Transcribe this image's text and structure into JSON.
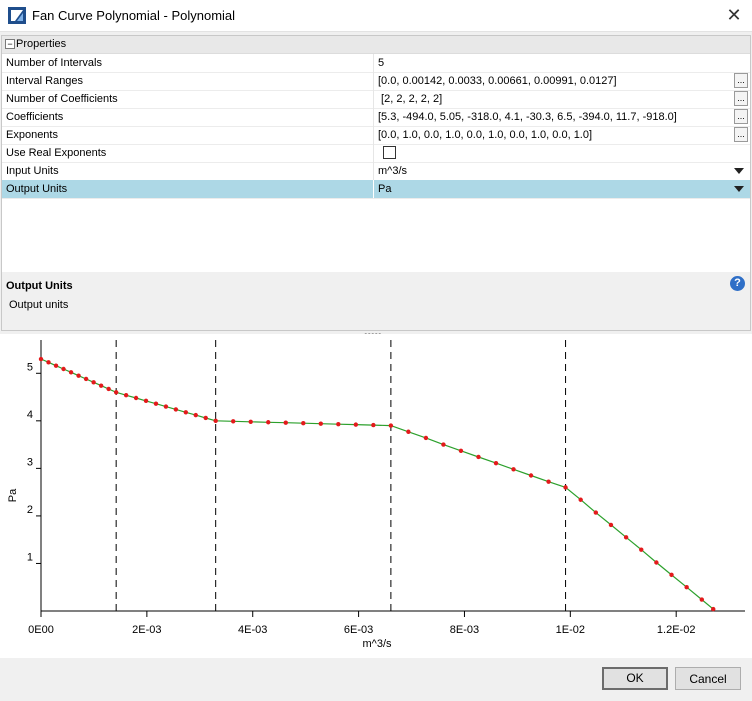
{
  "window": {
    "title": "Fan Curve Polynomial - Polynomial",
    "close_icon": "close-icon"
  },
  "properties": {
    "category": "Properties",
    "rows": [
      {
        "name": "Number of Intervals",
        "value": "5"
      },
      {
        "name": "Interval Ranges",
        "value": "[0.0, 0.00142, 0.0033, 0.00661, 0.00991, 0.0127]",
        "button": "..."
      },
      {
        "name": "Number of Coefficients",
        "value": " [2, 2, 2, 2, 2]",
        "button": "..."
      },
      {
        "name": "Coefficients",
        "value": "[5.3, -494.0, 5.05, -318.0, 4.1, -30.3, 6.5, -394.0, 11.7, -918.0]",
        "button": "..."
      },
      {
        "name": "Exponents",
        "value": "[0.0, 1.0, 0.0, 1.0, 0.0, 1.0, 0.0, 1.0, 0.0, 1.0]",
        "button": "..."
      },
      {
        "name": "Use Real Exponents",
        "value": "",
        "checked": false
      },
      {
        "name": "Input Units",
        "value": "m^3/s"
      },
      {
        "name": "Output Units",
        "value": "Pa",
        "selected": true
      }
    ]
  },
  "help": {
    "title": "Output Units",
    "description": "Output units",
    "icon": "help-icon",
    "icon_text": "?"
  },
  "splitter_grip": "•••••",
  "chart_data": {
    "type": "line",
    "xlabel": "m^3/s",
    "ylabel": "Pa",
    "xlim": [
      0,
      0.0133
    ],
    "ylim": [
      0,
      5.7
    ],
    "x_ticks": [
      0,
      0.002,
      0.004,
      0.006,
      0.008,
      0.01,
      0.012
    ],
    "x_tick_labels": [
      "0E00",
      "2E-03",
      "4E-03",
      "6E-03",
      "8E-03",
      "1E-02",
      "1.2E-02"
    ],
    "y_ticks": [
      1,
      2,
      3,
      4,
      5
    ],
    "y_tick_labels": [
      "1",
      "2",
      "3",
      "4",
      "5"
    ],
    "interval_boundaries": [
      0.00142,
      0.0033,
      0.00661,
      0.00991
    ],
    "line_color": "#2ca02c",
    "marker_color": "#e31a1c",
    "series": [
      {
        "x": [
          0,
          0.000142,
          0.000284,
          0.000426,
          0.000568,
          0.00071,
          0.000852,
          0.000994,
          0.001136,
          0.001278,
          0.00142,
          0.001608,
          0.001796,
          0.001984,
          0.002172,
          0.00236,
          0.002548,
          0.002736,
          0.002924,
          0.003112,
          0.0033,
          0.003631,
          0.003962,
          0.004293,
          0.004624,
          0.004955,
          0.005286,
          0.005617,
          0.005948,
          0.006279,
          0.00661,
          0.006941,
          0.007272,
          0.007603,
          0.007934,
          0.008265,
          0.008596,
          0.008927,
          0.009258,
          0.009589,
          0.00991,
          0.010196,
          0.010482,
          0.010768,
          0.011054,
          0.01134,
          0.011626,
          0.011912,
          0.012198,
          0.012484,
          0.0127
        ],
        "y": [
          5.3,
          5.23,
          5.16,
          5.09,
          5.02,
          4.95,
          4.88,
          4.81,
          4.74,
          4.67,
          4.6,
          4.54,
          4.48,
          4.42,
          4.36,
          4.3,
          4.24,
          4.18,
          4.12,
          4.06,
          4.0,
          3.99,
          3.98,
          3.97,
          3.96,
          3.95,
          3.94,
          3.93,
          3.92,
          3.91,
          3.9,
          3.77,
          3.64,
          3.5,
          3.37,
          3.24,
          3.11,
          2.98,
          2.85,
          2.72,
          2.6,
          2.34,
          2.07,
          1.81,
          1.55,
          1.29,
          1.02,
          0.76,
          0.5,
          0.24,
          0.04
        ]
      }
    ]
  },
  "buttons": {
    "ok": "OK",
    "cancel": "Cancel"
  }
}
